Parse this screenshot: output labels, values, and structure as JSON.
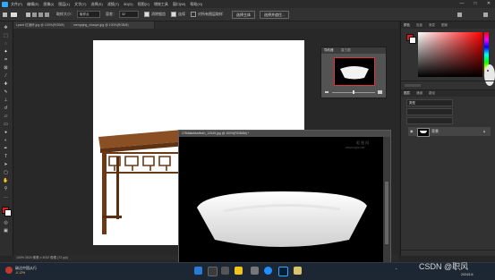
{
  "menubar": {
    "items": [
      "文件(F)",
      "编辑(E)",
      "图像(I)",
      "图层(L)",
      "文字(Y)",
      "选择(S)",
      "滤镜(T)",
      "3D(D)",
      "视图(V)",
      "增效工具",
      "窗口(W)",
      "帮助(H)"
    ],
    "minimize": "—",
    "maximize": "□",
    "close": "✕"
  },
  "options": {
    "sample_size_label": "取样大小：",
    "sample_size_value": "取样点",
    "tolerance_label": "容差：",
    "tolerance_value": "32",
    "antialias": "消除锯齿",
    "contiguous": "连续",
    "all_layers": "对所有图层取样",
    "select_subject": "选择主体",
    "select_mask": "选择并遮住..."
  },
  "doc_tabs": [
    "Lysed 红酒杯.jpg @ 100%(RGB/8)",
    "mengqing_chaoye.jpg @ 100%(RGB/8)"
  ],
  "doc_status": "100%   3024 像素 x 4032 像素 (72 ppi)",
  "navigator": {
    "tabs": [
      "导航器",
      "直方图"
    ]
  },
  "window2": {
    "title": "178dlaiobksffe4h_12549.jpg @ 100%(RGB/8#) *",
    "watermark_cn": "昵 图 网",
    "watermark_url": "www.nipic.net"
  },
  "right_panel": {
    "tabs": [
      "颜色",
      "色板",
      "渐变",
      "图案"
    ],
    "layer_tabs": [
      "图层",
      "通道",
      "路径"
    ],
    "kind_label": "类型",
    "layer_name": "背景"
  },
  "taskbar": {
    "weather_title": "碳达中国从行",
    "weather_value": "-0.12%",
    "time": "",
    "date": "2024/1/4",
    "csdn_watermark": "CSDN @职风"
  },
  "colors": {
    "accent": "#31a8ff",
    "foreground": "#e21c1c",
    "background": "#ffffff",
    "panel": "#323232"
  }
}
